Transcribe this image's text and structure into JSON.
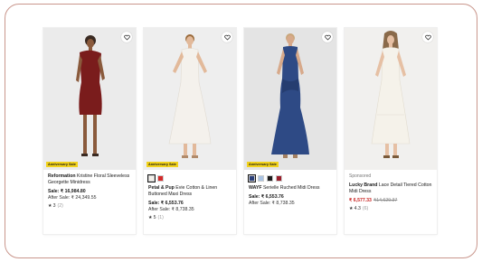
{
  "products": [
    {
      "badge": "Anniversary Sale",
      "brand": "Reformation",
      "name": "Kristine Floral Sleeveless Georgette Minidress",
      "sale_label": "Sale:",
      "sale_price": "₹ 16,984.80",
      "after_sale": "After Sale: ₹ 24,349.55",
      "rating": "3",
      "review_count": "(2)",
      "dress_color": "#7a1c1c"
    },
    {
      "badge": "Anniversary Sale",
      "brand": "Petal & Pup",
      "name": "Evie Cotton & Linen Buttoned Maxi Dress",
      "sale_label": "Sale:",
      "sale_price": "₹ 6,553.76",
      "after_sale": "After Sale: ₹ 8,738.35",
      "rating": "5",
      "review_count": "(1)",
      "swatches": [
        "#f3f0ea",
        "#d42a2a"
      ],
      "dress_color": "#f4f1ec"
    },
    {
      "badge": "Anniversary Sale",
      "brand": "WAYF",
      "name": "Serielle Ruched Midi Dress",
      "sale_label": "Sale:",
      "sale_price": "₹ 6,553.76",
      "after_sale": "After Sale: ₹ 8,738.35",
      "swatches": [
        "#2a3f7a",
        "#a9c3e3",
        "#1c1c1c",
        "#9b1d2a"
      ],
      "dress_color": "#2e4a85"
    },
    {
      "sponsored": "Sponsored",
      "brand": "Lucky Brand",
      "name": "Lace Detail Tiered Cotton Midi Dress",
      "sale_price": "₹ 6,577.33",
      "original_price": "₹14,629.37",
      "rating": "4.3",
      "review_count": "(6)",
      "dress_color": "#f5f2ea"
    }
  ],
  "colors": {
    "frame_border": "#c9968c",
    "badge_bg": "#f2d21b",
    "sale_red": "#c8211f"
  },
  "icons": {
    "favorite": "heart-icon",
    "rating": "star-icon"
  }
}
